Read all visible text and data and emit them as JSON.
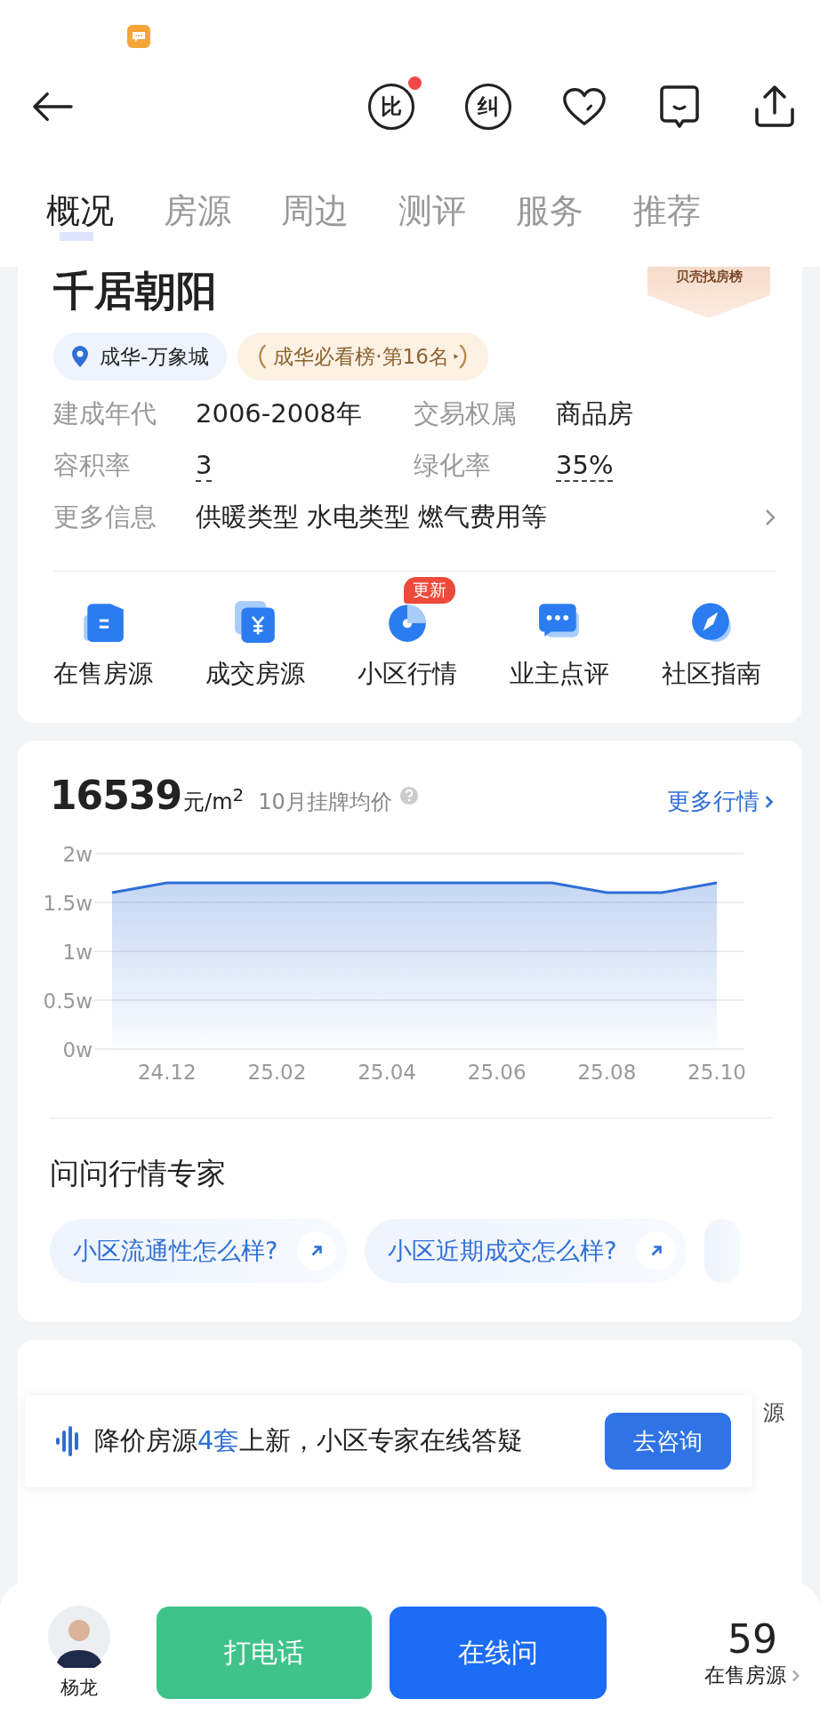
{
  "nav": {
    "compare_label": "比",
    "compare_badge": true,
    "correct_label": "纠"
  },
  "tabs": [
    {
      "label": "概况",
      "selected": true
    },
    {
      "label": "房源",
      "selected": false
    },
    {
      "label": "周边",
      "selected": false
    },
    {
      "label": "测评",
      "selected": false
    },
    {
      "label": "服务",
      "selected": false
    },
    {
      "label": "推荐",
      "selected": false
    }
  ],
  "community": {
    "name": "千居朝阳",
    "ranking_ribbon": "贝壳找房榜",
    "location": "成华-万象城",
    "award": "成华必看榜·第16名",
    "facts": [
      {
        "label": "建成年代",
        "value": "2006-2008年",
        "dashed": false
      },
      {
        "label": "交易权属",
        "value": "商品房",
        "dashed": false
      },
      {
        "label": "容积率",
        "value": "3",
        "dashed": true
      },
      {
        "label": "绿化率",
        "value": "35%",
        "dashed": true
      }
    ],
    "more": {
      "label": "更多信息",
      "value": "供暖类型 水电类型 燃气费用等"
    },
    "shortcuts": [
      {
        "label": "在售房源",
        "kind": "listing"
      },
      {
        "label": "成交房源",
        "kind": "deal"
      },
      {
        "label": "小区行情",
        "kind": "trend",
        "badge": "更新"
      },
      {
        "label": "业主点评",
        "kind": "review"
      },
      {
        "label": "社区指南",
        "kind": "guide"
      }
    ]
  },
  "price": {
    "value": "16539",
    "unit": "元/m$^{2}$",
    "caption": "10月挂牌均价",
    "more_link": "更多行情",
    "chart_data": {
      "type": "area",
      "categories": [
        null,
        "24.12",
        null,
        "25.02",
        null,
        "25.04",
        null,
        "25.06",
        null,
        "25.08",
        null,
        "25.10"
      ],
      "series": [
        {
          "color": "#2f6fd6",
          "values": [
            1.6,
            1.7,
            1.7,
            1.7,
            1.7,
            1.7,
            1.7,
            1.7,
            1.7,
            1.6,
            1.6,
            1.7
          ]
        }
      ],
      "ylim": [
        0,
        2
      ],
      "grid": true,
      "yticks": [
        {
          "value": 0,
          "label": "0w"
        },
        {
          "value": 0.5,
          "label": "0.5w"
        },
        {
          "value": 1,
          "label": "1w"
        },
        {
          "value": 1.5,
          "label": "1.5w"
        },
        {
          "value": 2,
          "label": "2w"
        }
      ]
    }
  },
  "expert": {
    "title": "问问行情专家",
    "questions": [
      "小区流通性怎么样?",
      "小区近期成交怎么样?"
    ]
  },
  "listings_card": {
    "title_tail": "源"
  },
  "banner": {
    "text": "降价房源**4套**上新，小区专家在线答疑",
    "button": "去咨询"
  },
  "bottom_bar": {
    "agent_name": "杨龙",
    "call_button": "打电话",
    "chat_button": "在线问",
    "count": "59",
    "count_label": "在售房源"
  }
}
